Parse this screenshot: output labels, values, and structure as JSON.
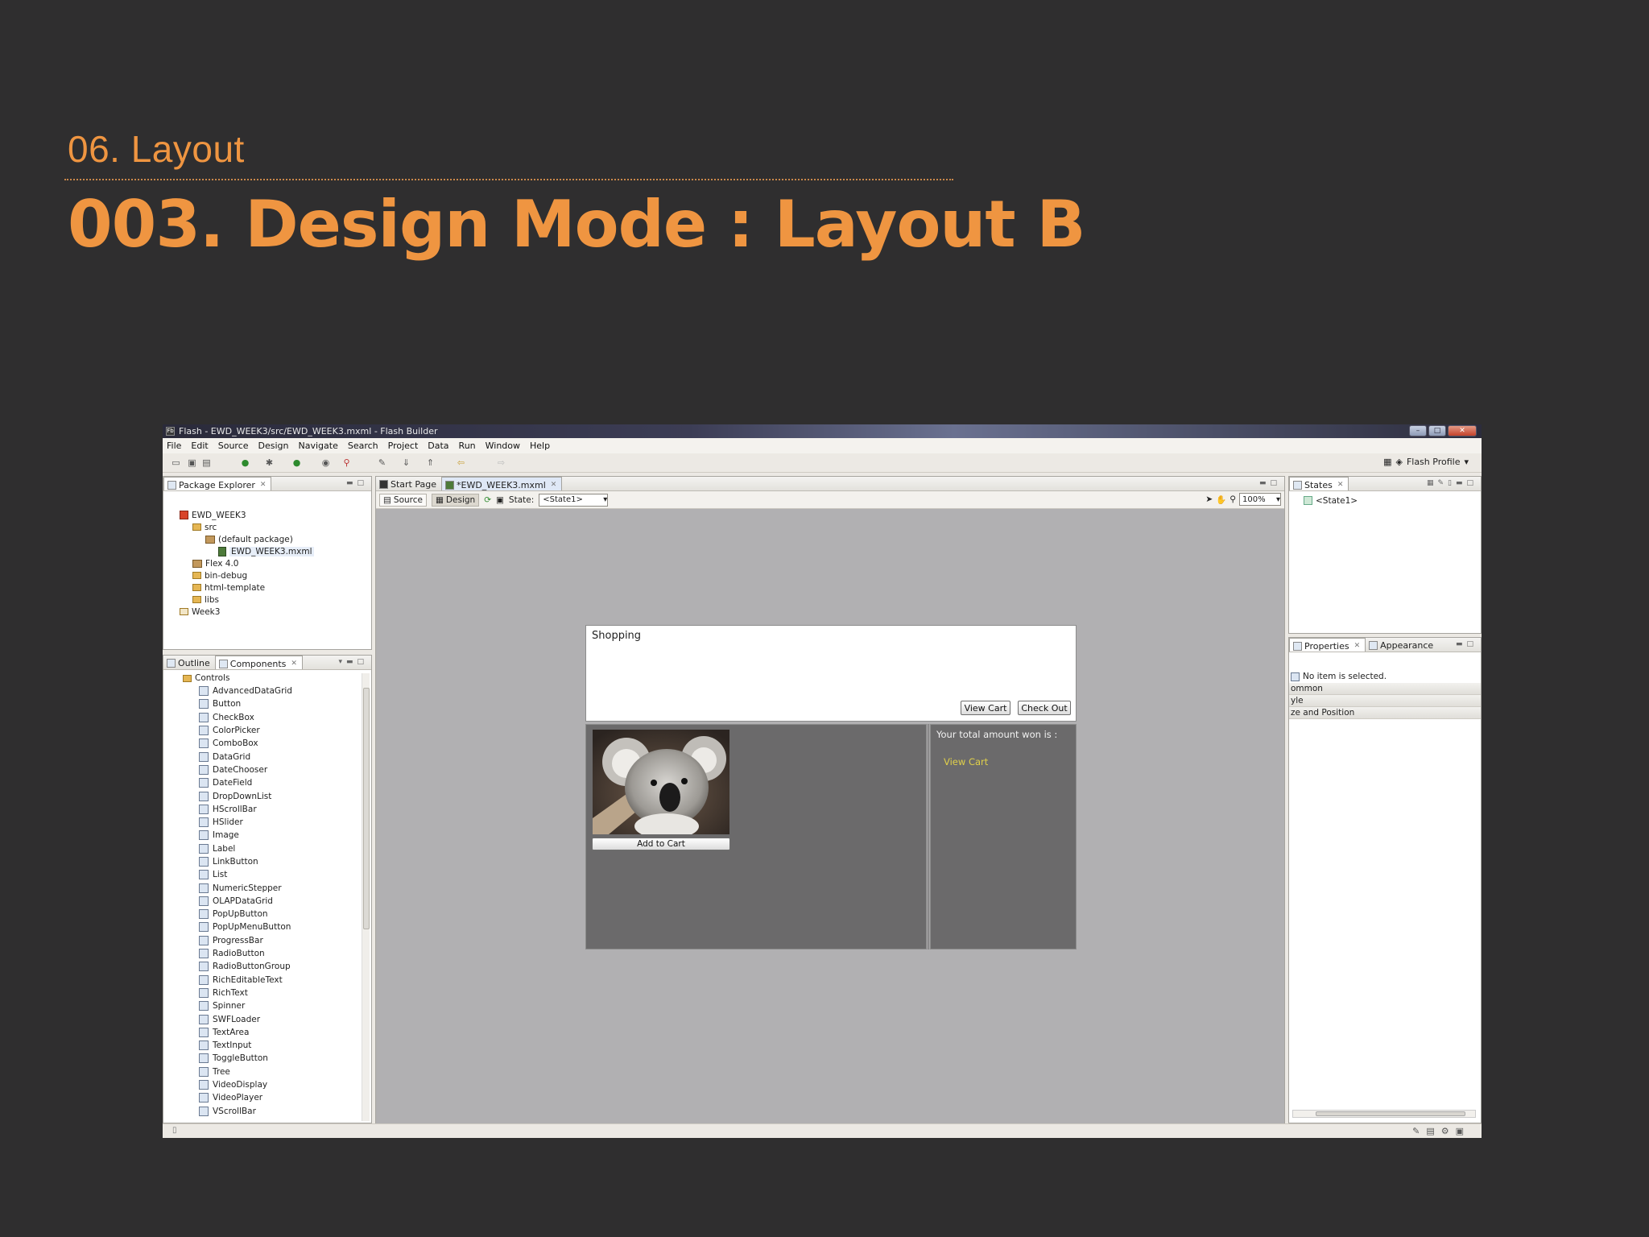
{
  "slide": {
    "subtitle": "06.  Layout",
    "title": "003. Design Mode : Layout  B"
  },
  "window": {
    "title": "Flash - EWD_WEEK3/src/EWD_WEEK3.mxml - Flash Builder"
  },
  "menu": [
    "File",
    "Edit",
    "Source",
    "Design",
    "Navigate",
    "Search",
    "Project",
    "Data",
    "Run",
    "Window",
    "Help"
  ],
  "perspective": {
    "label": "Flash Profile"
  },
  "package_explorer": {
    "tab": "Package Explorer",
    "tree": [
      "EWD_WEEK3",
      "src",
      "(default package)",
      "EWD_WEEK3.mxml",
      "Flex 4.0",
      "bin-debug",
      "html-template",
      "libs",
      "Week3"
    ]
  },
  "bottom_left": {
    "tabs": [
      "Outline",
      "Components"
    ],
    "group": "Controls",
    "components": [
      "AdvancedDataGrid",
      "Button",
      "CheckBox",
      "ColorPicker",
      "ComboBox",
      "DataGrid",
      "DateChooser",
      "DateField",
      "DropDownList",
      "HScrollBar",
      "HSlider",
      "Image",
      "Label",
      "LinkButton",
      "List",
      "NumericStepper",
      "OLAPDataGrid",
      "PopUpButton",
      "PopUpMenuButton",
      "ProgressBar",
      "RadioButton",
      "RadioButtonGroup",
      "RichEditableText",
      "RichText",
      "Spinner",
      "SWFLoader",
      "TextArea",
      "TextInput",
      "ToggleButton",
      "Tree",
      "VideoDisplay",
      "VideoPlayer",
      "VScrollBar"
    ]
  },
  "editor": {
    "tabs": [
      "Start Page",
      "*EWD_WEEK3.mxml"
    ],
    "source_label": "Source",
    "design_label": "Design",
    "state_label": "State:",
    "state_value": "<State1>",
    "zoom_value": "100%"
  },
  "app": {
    "header": "Shopping",
    "view_cart_button": "View Cart",
    "check_out_button": "Check Out",
    "add_to_cart_button": "Add to Cart",
    "total_label": "Your total amount won is :",
    "view_cart_link": "View Cart"
  },
  "states_panel": {
    "tab": "States",
    "item": "<State1>"
  },
  "properties_panel": {
    "tabs": [
      "Properties",
      "Appearance"
    ],
    "no_selection": "No item is selected.",
    "sections": [
      "ommon",
      "yle",
      "ze and Position"
    ]
  }
}
